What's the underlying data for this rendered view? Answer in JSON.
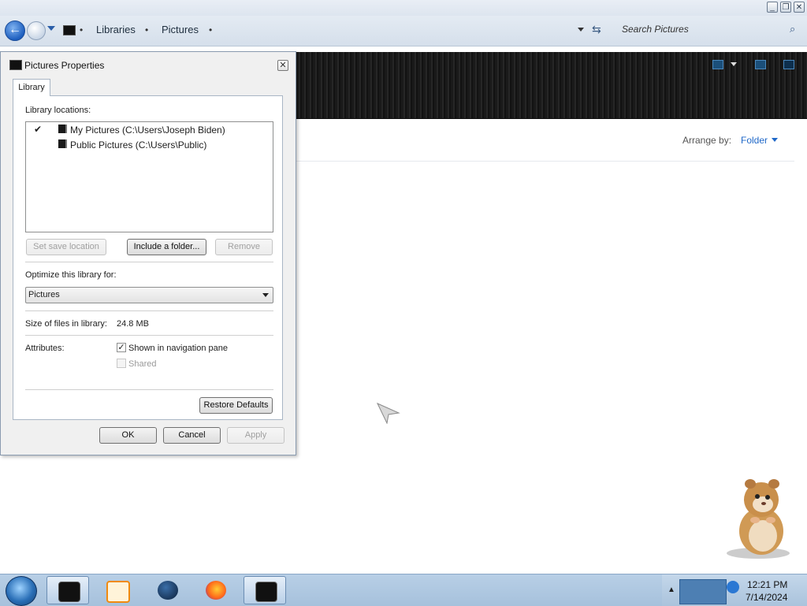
{
  "window": {
    "controls": [
      "minimize",
      "restore",
      "close"
    ],
    "breadcrumb": [
      "Libraries",
      "Pictures"
    ],
    "search_placeholder": "Search Pictures",
    "arrange_label": "Arrange by:",
    "arrange_value": "Folder"
  },
  "dialog": {
    "title": "Pictures Properties",
    "tab": "Library",
    "locations_label": "Library locations:",
    "locations": [
      {
        "label": "My Pictures (C:\\Users\\Joseph Biden)",
        "default": true
      },
      {
        "label": "Public Pictures (C:\\Users\\Public)",
        "default": false
      }
    ],
    "buttons": {
      "set_save_location": "Set save location",
      "include_folder": "Include a folder...",
      "remove": "Remove",
      "restore_defaults": "Restore Defaults",
      "ok": "OK",
      "cancel": "Cancel",
      "apply": "Apply"
    },
    "optimize_label": "Optimize this library for:",
    "optimize_value": "Pictures",
    "size_label": "Size of files in library:",
    "size_value": "24.8 MB",
    "attributes_label": "Attributes:",
    "shown_in_nav_label": "Shown in navigation pane",
    "shown_in_nav_checked": true,
    "shared_label": "Shared",
    "shared_checked": false
  },
  "taskbar": {
    "apps": [
      "explorer",
      "media-player",
      "network-globe",
      "firefox",
      "library-window"
    ],
    "time": "12:21 PM",
    "date": "7/14/2024"
  },
  "colors": {
    "accent_link": "#1f68c8",
    "taskbar": "#a6c1dc"
  }
}
